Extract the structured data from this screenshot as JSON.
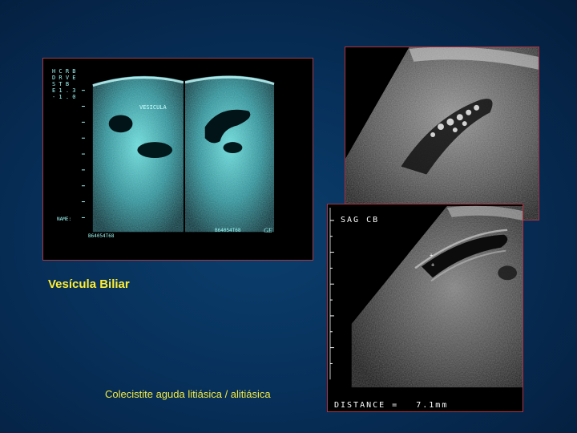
{
  "captions": {
    "title": "Vesícula Biliar",
    "subtitle": "Colecistite aguda litiásica / alitiásica"
  },
  "images": {
    "left_scan": {
      "label": "VESICULA",
      "id_left": "B64054T68",
      "id_right": "B64054T68",
      "logo": "GE",
      "side_marker": "NAME:",
      "header_lines": [
        "H C R B",
        "D R V E",
        "S T B",
        "E 1 . 3",
        "- 1 . 0"
      ]
    },
    "right_bottom_scan": {
      "label": "SAG CB",
      "measurement_label": "DISTANCE =",
      "measurement_value": "7.1mm"
    }
  },
  "colors": {
    "background": "#062b52",
    "frame_border": "#b0303e",
    "caption_title": "#ffee33",
    "caption_subtitle": "#f2ea42",
    "left_scan_tint": "#8ef4ee"
  }
}
